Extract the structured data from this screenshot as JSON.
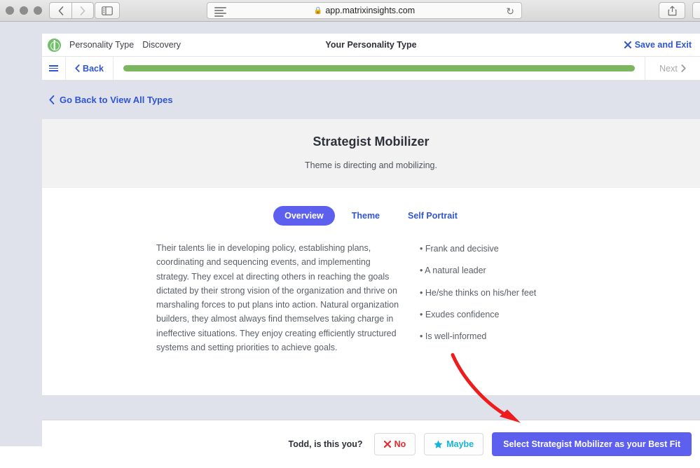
{
  "browser": {
    "url": "app.matrixinsights.com",
    "lock_icon": "lock-icon",
    "reload_icon": "reload-icon",
    "back_icon": "chevron-left-icon",
    "forward_icon": "chevron-right-icon",
    "sidebar_icon": "sidebar-toggle-icon",
    "reader_icon": "reader-view-icon",
    "share_icon": "share-icon"
  },
  "app_header": {
    "logo_icon": "compass-wheel-logo",
    "product_name": "Personality Type",
    "section_name": "Discovery",
    "title": "Your Personality Type",
    "save_exit_label": "Save and Exit",
    "save_exit_icon": "close-x-icon"
  },
  "nav_row": {
    "menu_icon": "hamburger-menu-icon",
    "back_label": "Back",
    "back_icon": "chevron-left-icon",
    "next_label": "Next",
    "next_icon": "chevron-right-icon",
    "progress_percent": 100,
    "progress_color": "#7cb65e"
  },
  "breadcrumb": {
    "icon": "chevron-left-icon",
    "label": "Go Back to View All Types"
  },
  "type_card": {
    "title": "Strategist Mobilizer",
    "subtitle": "Theme is directing and mobilizing.",
    "tabs": [
      {
        "label": "Overview",
        "active": true
      },
      {
        "label": "Theme",
        "active": false
      },
      {
        "label": "Self Portrait",
        "active": false
      }
    ],
    "description": "Their talents lie in developing policy, establishing plans, coordinating and sequencing events, and implementing strategy. They excel at directing others in reaching the goals dictated by their strong vision of the organization and thrive on marshaling forces to put plans into action. Natural organization builders, they almost always find themselves taking charge in ineffective situations. They enjoy creating efficiently structured systems and setting priorities to achieve goals.",
    "traits": [
      "• Frank and decisive",
      "• A natural leader",
      "• He/she thinks on his/her feet",
      "• Exudes confidence",
      "• Is well-informed"
    ]
  },
  "action_bar": {
    "question": "Todd, is this you?",
    "no_label": "No",
    "no_icon": "x-mark-icon",
    "maybe_label": "Maybe",
    "maybe_icon": "star-icon",
    "primary_label": "Select Strategist Mobilizer as your Best Fit"
  },
  "annotation": {
    "arrow_icon": "red-curved-arrow",
    "color": "#ee1c1c"
  },
  "colors": {
    "accent_blue": "#2f55d4",
    "primary_purple": "#5d5fef",
    "progress_green": "#7cb65e",
    "danger_red": "#e8272c",
    "maybe_cyan": "#15b5d6",
    "page_bg": "#dfe2ea",
    "card_head_bg": "#f2f2f3"
  }
}
